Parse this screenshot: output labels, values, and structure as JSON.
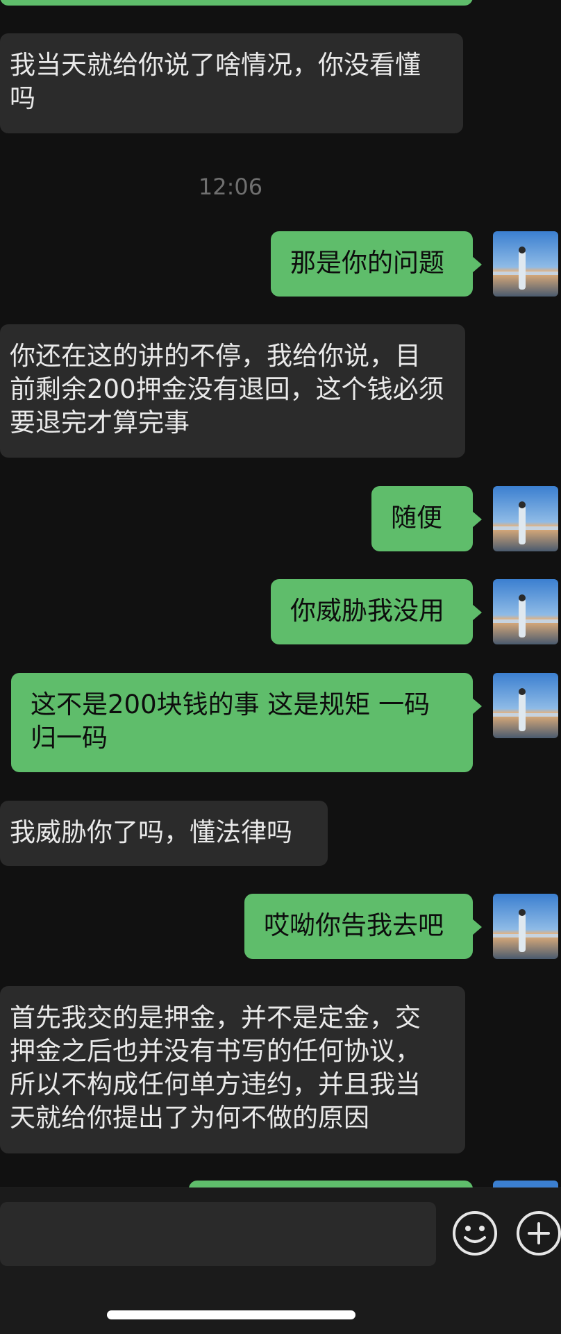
{
  "messages": [
    {
      "side": "in",
      "text": "我当天就给你说了啥情况，你没看懂吗"
    },
    {
      "side": "out",
      "text": "那是你的问题"
    },
    {
      "side": "in",
      "text": "你还在这的讲的不停，我给你说，目前剩余200押金没有退回，这个钱必须要退完才算完事"
    },
    {
      "side": "out",
      "text": "随便"
    },
    {
      "side": "out",
      "text": "你威胁我没用"
    },
    {
      "side": "out",
      "text": "这不是200块钱的事 这是规矩 一码归一码"
    },
    {
      "side": "in",
      "text": "我威胁你了吗，懂法律吗"
    },
    {
      "side": "out",
      "text": "哎呦你告我去吧"
    },
    {
      "side": "in",
      "text": "首先我交的是押金，并不是定金，交押金之后也并没有书写的任何协议，所以不构成任何单方违约，并且我当天就给你提出了为何不做的原因"
    }
  ],
  "timestamp": "12:06",
  "input_bar": {
    "emoji_icon": "emoji-face-icon",
    "plus_icon": "plus-circle-icon"
  },
  "colors": {
    "background": "#111111",
    "incoming_bubble": "#2b2b2b",
    "outgoing_bubble": "#5fbd6b"
  }
}
